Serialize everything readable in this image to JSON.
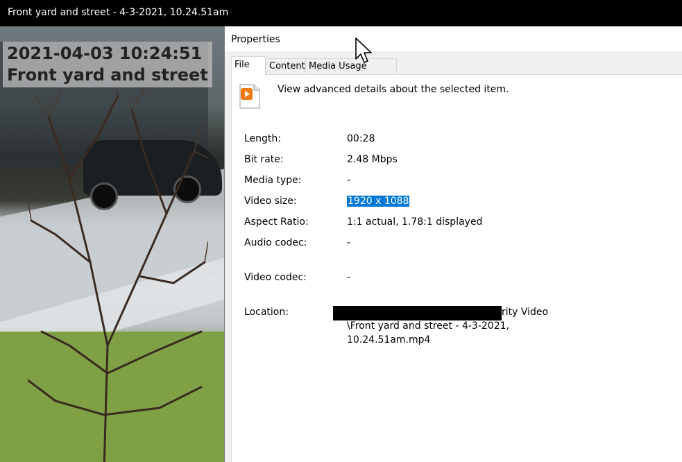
{
  "player": {
    "title": "Front yard and street - 4-3-2021, 10.24.51am",
    "osd_timestamp": "2021-04-03 10:24:51",
    "osd_camera": "Front yard and street"
  },
  "dialog": {
    "title": "Properties",
    "tabs": [
      {
        "label": "File",
        "active": true
      },
      {
        "label": "Content",
        "active": false
      },
      {
        "label": "Media Usage Rights",
        "active": false
      }
    ],
    "file_icon": "video-file-icon",
    "description": "View advanced details about the selected item.",
    "details": {
      "length": {
        "label": "Length:",
        "value": "00:28"
      },
      "bit_rate": {
        "label": "Bit rate:",
        "value": "2.48 Mbps"
      },
      "media_type": {
        "label": "Media type:",
        "value": "-"
      },
      "video_size": {
        "label": "Video size:",
        "value": "1920 x 1088"
      },
      "aspect_ratio": {
        "label": "Aspect Ratio:",
        "value": "1:1 actual, 1.78:1 displayed"
      },
      "audio_codec": {
        "label": "Audio codec:",
        "value": "-"
      },
      "video_codec": {
        "label": "Video codec:",
        "value": "-"
      },
      "location": {
        "label": "Location:",
        "line1_visible_suffix": "rity Video",
        "line2": "\\Front yard and street - 4-3-2021,",
        "line3": "10.24.51am.mp4"
      }
    }
  },
  "colors": {
    "selection": "#0078d7",
    "title_bar": "#000000",
    "dialog_bg": "#ffffff",
    "tab_area_bg": "#f0f0f0"
  }
}
